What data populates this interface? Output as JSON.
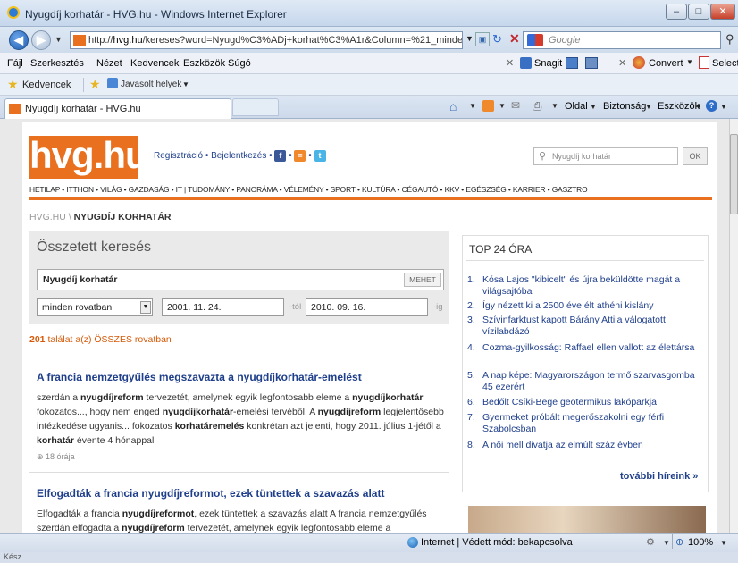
{
  "window": {
    "title": "Nyugdíj korhatár - HVG.hu - Windows Internet Explorer",
    "minimize": "–",
    "maximize": "□",
    "close": "✕"
  },
  "address": {
    "url_prefix": "http://",
    "url_host": "hvg.hu",
    "url_path": "/kereses?word=Nyugd%C3%ADj+korhat%C3%A1r&Column=%21_minden_rovat",
    "search_placeholder": "Google"
  },
  "menu": {
    "items": [
      "Fájl",
      "Szerkesztés",
      "Nézet",
      "Kedvencek",
      "Eszközök",
      "Súgó"
    ],
    "snagit": "Snagit",
    "convert": "Convert",
    "select": "Select"
  },
  "favorites": {
    "label": "Kedvencek",
    "suggested": "Javasolt helyek"
  },
  "tab": {
    "title": "Nyugdíj korhatár - HVG.hu"
  },
  "commandbar": {
    "page": "Oldal",
    "safety": "Biztonság",
    "tools": "Eszközök"
  },
  "site": {
    "logo": "hvg.hu",
    "register": "Regisztráció",
    "login": "Bejelentkezés",
    "search_placeholder": "Nyugdíj korhatár",
    "ok": "OK",
    "nav": "HETILAP • ITTHON • VILÁG • GAZDASÁG • IT | TUDOMÁNY • PANORÁMA • VÉLEMÉNY • SPORT • KULTÚRA • CÉGAUTÓ • KKV • EGÉSZSÉG • KARRIER • GASZTRO",
    "breadcrumb_root": "HVG.HU \\ ",
    "breadcrumb_current": "NYUGDÍJ KORHATÁR"
  },
  "search": {
    "title": "Összetett keresés",
    "keyword": "Nyugdíj korhatár",
    "submit": "MEHET",
    "rovat": "minden rovatban",
    "date_from": "2001. 11. 24.",
    "from_suffix": "-tól",
    "date_to": "2010. 09. 16.",
    "to_suffix": "-ig",
    "result_count": "201",
    "result_text": " találat a(z) ÖSSZES rovatban"
  },
  "articles": [
    {
      "title": "A francia nemzetgyűlés megszavazta a nyugdíjkorhatár-emelést",
      "body": [
        [
          "szerdán a ",
          false
        ],
        [
          "nyugdíjreform",
          true
        ],
        [
          " tervezetét, amelynek egyik legfontosabb eleme a ",
          false
        ],
        [
          "nyugdíjkorhatár",
          true
        ],
        [
          " fokozatos..., hogy nem enged ",
          false
        ],
        [
          "nyugdíjkorhatár",
          true
        ],
        [
          "-emelési tervéből. A ",
          false
        ],
        [
          "nyugdíjreform",
          true
        ],
        [
          " legjelentősebb intézkedése ugyanis... fokozatos ",
          false
        ],
        [
          "korhatáremelés",
          true
        ],
        [
          " konkrétan azt jelenti, hogy 2011. július 1-jétől a ",
          false
        ],
        [
          "korhatár",
          true
        ],
        [
          " évente 4 hónappal",
          false
        ]
      ],
      "time": "18 órája"
    },
    {
      "title": "Elfogadták a francia nyugdíjreformot, ezek tüntettek a szavazás alatt",
      "body": [
        [
          "Elfogadták a francia ",
          false
        ],
        [
          "nyugdíjreformot",
          true
        ],
        [
          ", ezek tüntettek a szavazás alatt A francia nemzetgyűlés szerdán elfogadta a ",
          false
        ],
        [
          "nyugdíjreform",
          true
        ],
        [
          " tervezetét, amelynek egyik legfontosabb eleme a",
          false
        ]
      ],
      "time": ""
    }
  ],
  "top24": {
    "title": "TOP 24 ÓRA",
    "items": [
      "Kósa Lajos \"kibicelt\" és újra beküldötte magát a világsajtóba",
      "Így nézett ki a 2500 éve élt athéni kislány",
      "Szívinfarktust kapott Bárány Attila válogatott vízilabdázó",
      "Cozma-gyilkosság: Raffael ellen vallott az élettársa",
      "A nap képe: Magyarországon termő szarvasgomba 45 ezerért",
      "Bedőlt Csíki-Bege geotermikus lakóparkja",
      "Gyermeket próbált megerőszakolni egy férfi Szabolcsban",
      "A női mell divatja az elmúlt száz évben"
    ],
    "more": "további híreink »"
  },
  "status": {
    "zone": "Internet | Védett mód: bekapcsolva",
    "zoom": "100%",
    "ready": "Kész"
  }
}
